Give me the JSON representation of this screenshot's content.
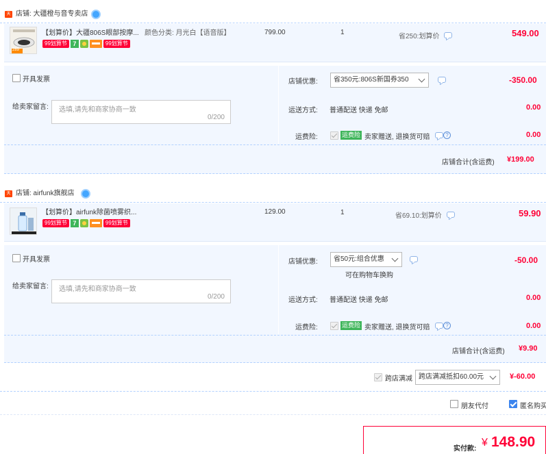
{
  "shops": [
    {
      "name": "店铺: 大疆橙与音专卖店",
      "item": {
        "title": "【划算价】大疆806S眼部按摩...",
        "sku": "颜色分类: 月光白【语音版】",
        "unit_price": "799.00",
        "qty": "1",
        "save_note": "省250:划算价",
        "subtotal": "549.00",
        "badge_99": "99划算节",
        "badge_7": "7",
        "thumb_caption": "289"
      },
      "invoice_label": "开具发票",
      "msg_label": "给卖家留言:",
      "msg_placeholder": "选填,请先和商家协商一致",
      "msg_count": "0/200",
      "discount_label": "店铺优惠:",
      "discount_value": "省350元:806S新国券350",
      "discount_amount": "-350.00",
      "shipping_label": "运送方式:",
      "shipping_value": "普通配送 快递 免邮",
      "shipping_amount": "0.00",
      "insurance_label": "运费险:",
      "insurance_badge": "运费险",
      "insurance_text": "卖家赠送, 退换货可赔",
      "insurance_amount": "0.00",
      "total_label": "店铺合计(含运费)",
      "total_value": "¥199.00"
    },
    {
      "name": "店铺: airfunk旗舰店",
      "item": {
        "title": "【划算价】airfunk除菌喷雾织...",
        "unit_price": "129.00",
        "qty": "1",
        "save_note": "省69.10:划算价",
        "subtotal": "59.90",
        "badge_99": "99划算节",
        "badge_7": "7"
      },
      "invoice_label": "开具发票",
      "msg_label": "给卖家留言:",
      "msg_placeholder": "选填,请先和商家协商一致",
      "msg_count": "0/200",
      "discount_label": "店铺优惠:",
      "discount_value": "省50元:组合优惠",
      "discount_sub": "可在购物车换购",
      "discount_amount": "-50.00",
      "shipping_label": "运送方式:",
      "shipping_value": "普通配送 快递 免邮",
      "shipping_amount": "0.00",
      "insurance_label": "运费险:",
      "insurance_badge": "运费险",
      "insurance_text": "卖家赠送, 退换货可赔",
      "insurance_amount": "0.00",
      "total_label": "店铺合计(含运费)",
      "total_value": "¥9.90"
    }
  ],
  "cross_store": {
    "label": "跨店满减",
    "select_value": "跨店满减抵扣60.00元",
    "amount": "¥-60.00"
  },
  "options": {
    "friend_pay": "朋友代付",
    "anonymous": "匿名购买"
  },
  "payment": {
    "label": "实付款:",
    "currency": "¥",
    "amount": "148.90"
  },
  "colors": {
    "accent_red": "#ff0036",
    "bg_blue": "#f2f7ff",
    "badge_green": "#3eb55a"
  }
}
